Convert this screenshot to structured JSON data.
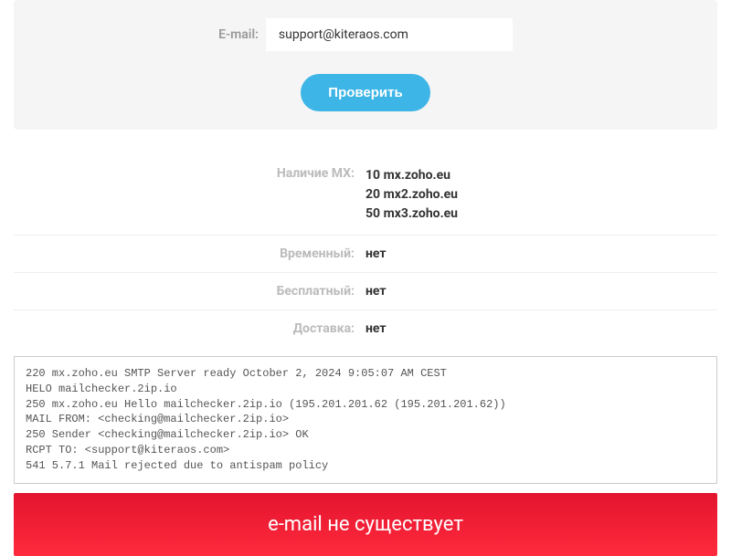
{
  "form": {
    "email_label": "E-mail:",
    "email_value": "support@kiteraos.com",
    "check_button": "Проверить"
  },
  "results": {
    "mx_label": "Наличие MX:",
    "mx_records": [
      {
        "priority": "10",
        "host": "mx.zoho.eu"
      },
      {
        "priority": "20",
        "host": "mx2.zoho.eu"
      },
      {
        "priority": "50",
        "host": "mx3.zoho.eu"
      }
    ],
    "temporary_label": "Временный:",
    "temporary_value": "нет",
    "free_label": "Бесплатный:",
    "free_value": "нет",
    "delivery_label": "Доставка:",
    "delivery_value": "нет"
  },
  "smtp_log": "220 mx.zoho.eu SMTP Server ready October 2, 2024 9:05:07 AM CEST\nHELO mailchecker.2ip.io\n250 mx.zoho.eu Hello mailchecker.2ip.io (195.201.201.62 (195.201.201.62))\nMAIL FROM: <checking@mailchecker.2ip.io>\n250 Sender <checking@mailchecker.2ip.io> OK\nRCPT TO: <support@kiteraos.com>\n541 5.7.1 Mail rejected due to antispam policy",
  "status_text": "e-mail не существует"
}
